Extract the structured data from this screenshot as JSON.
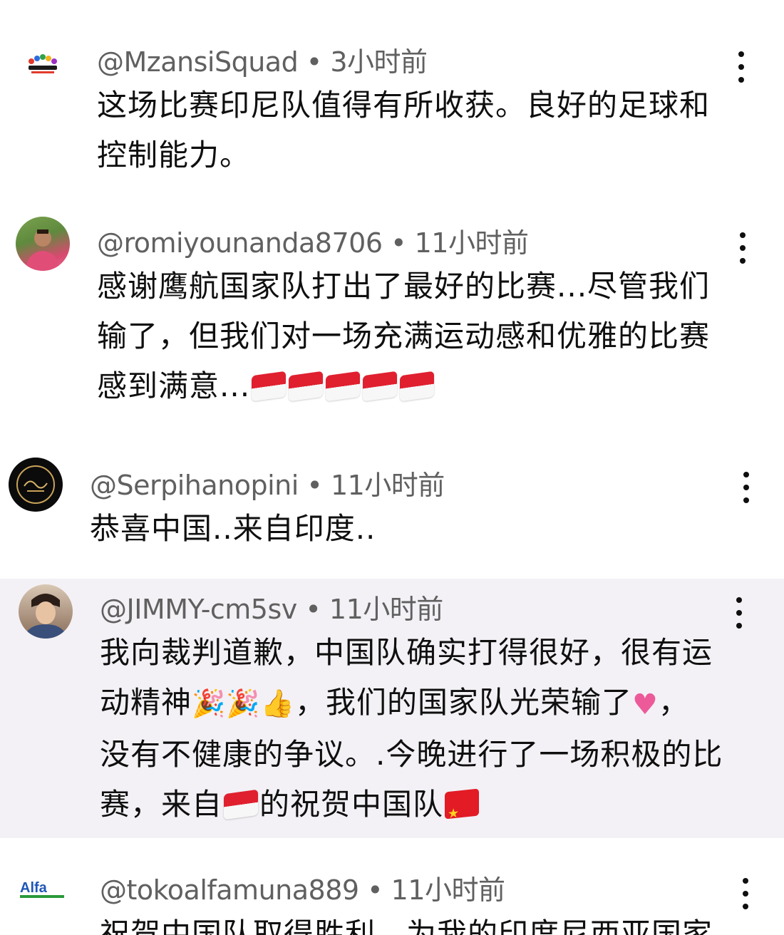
{
  "comments": [
    {
      "author": "@MzansiSquad",
      "time": "3小时前",
      "separator": "•",
      "lines": [
        "这场比赛印尼队值得有所收获。良好的足球和",
        "控制能力。"
      ],
      "avatar_label": "Mzansi Squad logo"
    },
    {
      "author": "@romiyounanda8706",
      "time": "11小时前",
      "separator": "•",
      "lines": [
        "感谢鹰航国家队打出了最好的比赛...尽管我们",
        "输了，但我们对一场充满运动感和优雅的比赛",
        "感到满意..."
      ]
    },
    {
      "author": "@Serpihanopini",
      "time": "11小时前",
      "separator": "•",
      "lines": [
        "恭喜中国..来自印度.."
      ]
    },
    {
      "author": "@JIMMY-cm5sv",
      "time": "11小时前",
      "separator": "•",
      "line1": "我向裁判道歉，中国队确实打得很好，很有运",
      "line2a": "动精神",
      "line2b": "，我们的国家队光荣输了",
      "line2c": "，",
      "line3": "没有不健康的争议。.今晚进行了一场积极的比",
      "line4a": "赛，来自",
      "line4b": "的祝贺中国队"
    },
    {
      "author": "@tokoalfamuna889",
      "time": "11小时前",
      "separator": "•",
      "lines": [
        "祝贺中国队取得胜利，为我的印度尼西亚国家"
      ],
      "avatar_text": "Alfa"
    }
  ],
  "icons": {
    "more": "more-vertical-icon",
    "flag_indonesia": "indonesia-flag-icon",
    "flag_china": "china-flag-icon",
    "heart": "heart-icon",
    "thumbs_up": "thumbs-up-icon",
    "party": "party-popper-icon"
  },
  "colors": {
    "highlight_bg": "#f3f1f5",
    "meta_text": "#606060",
    "body_text": "#0f0f0f"
  }
}
